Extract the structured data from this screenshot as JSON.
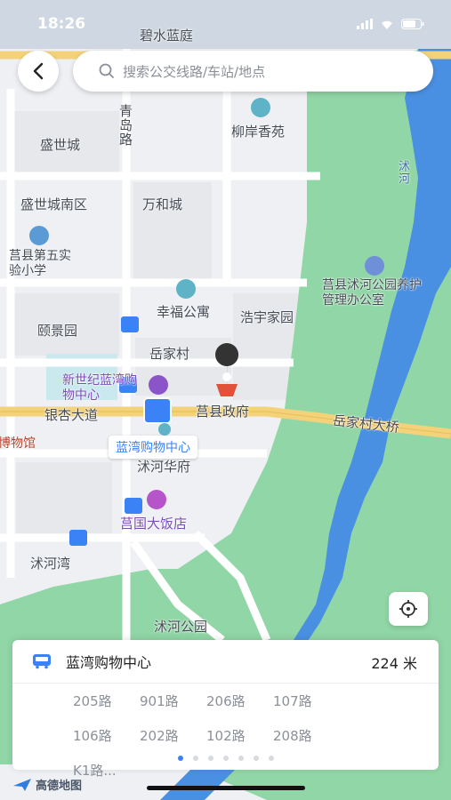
{
  "status_bar": {
    "time": "18:26"
  },
  "search": {
    "placeholder": "搜索公交线路/车站/地点"
  },
  "map": {
    "labels": {
      "bishui": "碧水蓝庭",
      "qingdao_road": "青岛路",
      "liuan": "柳岸香苑",
      "shengshicheng": "盛世城",
      "shuhe_river": "沭河",
      "shengshi_south": "盛世城南区",
      "wanhecheng": "万和城",
      "school": "莒县第五实验小学",
      "park_office": "莒县沭河公园养护管理办公室",
      "xingfu": "幸福公寓",
      "haoyu": "浩宇家园",
      "yijing": "颐景园",
      "yuejia": "岳家村",
      "mall_name": "新世纪蓝湾购物中心",
      "gov": "莒县政府",
      "yinxing": "银杏大道",
      "bridge": "岳家村大桥",
      "museum_partial": "博物馆",
      "bus_stop_callout": "蓝湾购物中心",
      "shuhe_huafu": "沭河华府",
      "hotel": "莒国大饭店",
      "shuhe_wan": "沭河湾",
      "shuhe_park": "沭河公园"
    }
  },
  "stop_panel": {
    "stop_name": "蓝湾购物中心",
    "distance": "224 米",
    "routes": [
      "205路",
      "901路",
      "206路",
      "107路",
      "106路",
      "202路",
      "102路",
      "208路",
      "K1路..."
    ],
    "page_count": 7,
    "active_page": 1
  },
  "brand": {
    "name": "高德地图"
  },
  "colors": {
    "accent": "#3b82f6",
    "water": "#4a90e2",
    "park": "#8fd3a0",
    "road_yellow": "#f3d27a"
  }
}
